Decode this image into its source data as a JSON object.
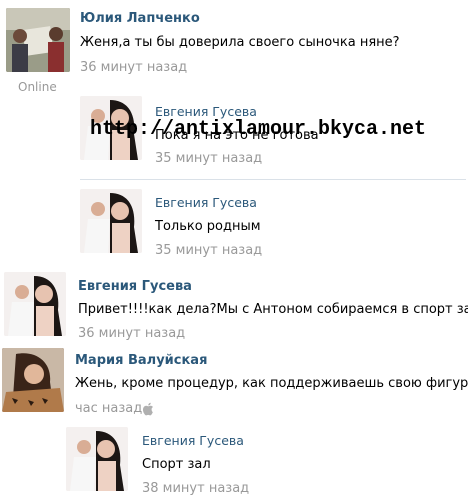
{
  "messages": [
    {
      "author": "Юлия Лапченко",
      "text": "Женя,а ты бы доверила своего сыночка няне?",
      "time": "36 минут назад",
      "status": "Online"
    },
    {
      "author": "Евгения Гусева",
      "text": "Пока я на это не готова",
      "time": "35 минут назад"
    },
    {
      "author": "Евгения Гусева",
      "text": "Только родным",
      "time": "35 минут назад"
    },
    {
      "author": "Евгения Гусева",
      "text": "Привет!!!!как дела?Мы с Антоном собираемся в спорт зал",
      "time": "36 минут назад"
    },
    {
      "author": "Мария Валуйская",
      "text": "Жень, кроме процедур, как поддерживаешь свою фигуру?)",
      "time": "час назад"
    },
    {
      "author": "Евгения Гусева",
      "text": "Спорт зал",
      "time": "38 минут назад"
    }
  ],
  "watermark": "http://antixlamour.bkyca.net",
  "colors": {
    "name": "#2b587a",
    "time": "#999999",
    "divider": "#dae1e8"
  }
}
